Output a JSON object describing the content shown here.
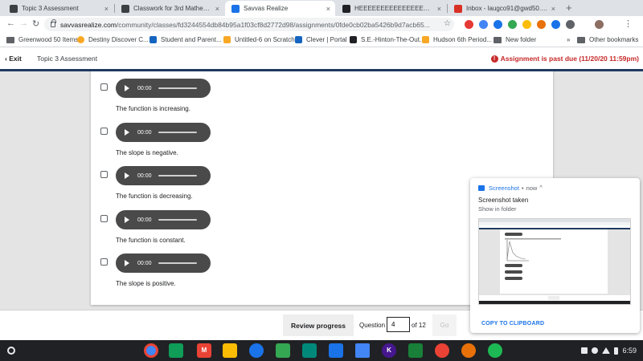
{
  "tabs": [
    {
      "title": "Topic 3 Assessment",
      "favicon_color": "#3c4043",
      "active": false
    },
    {
      "title": "Classwork for 3rd Mathematics",
      "favicon_color": "#3c4043",
      "active": false
    },
    {
      "title": "Savvas Realize",
      "favicon_color": "#1a73e8",
      "active": true
    },
    {
      "title": "HEEEEEEEEEEEEEEEEEEEEEEE",
      "favicon_color": "#202124",
      "active": false
    },
    {
      "title": "Inbox - laugco91@gwd50.org",
      "favicon_color": "#d93025",
      "active": false
    }
  ],
  "tab_close_glyph": "×",
  "new_tab_glyph": "+",
  "omnibox": {
    "host": "savvasrealize.com",
    "path": "/community/classes/fd3244554db84b95a1f03cf8d2772d98/assignments/0fde0cb02ba5426b9d7acb65..."
  },
  "extensions": [
    "#e53935",
    "#4285f4",
    "#1a73e8",
    "#34a853",
    "#fbbc04",
    "#e8710a",
    "#5f6368"
  ],
  "bookmarks": [
    {
      "label": "Greenwood 50 Items",
      "icon": "folder-icon",
      "color": "#5f6368"
    },
    {
      "label": "Destiny Discover C...",
      "icon": "destiny-icon",
      "color": "#f9a825"
    },
    {
      "label": "Student and Parent...",
      "icon": "sis-icon",
      "color": "#1565c0"
    },
    {
      "label": "Untitled-6 on Scratch",
      "icon": "scratch-icon",
      "color": "#f9a825"
    },
    {
      "label": "Clever | Portal",
      "icon": "clever-icon",
      "color": "#1565c0"
    },
    {
      "label": "S.E.-Hinton-The-Out...",
      "icon": "doc-icon",
      "color": "#202124"
    },
    {
      "label": "Hudson 6th Period...",
      "icon": "classroom-icon",
      "color": "#f9a825"
    },
    {
      "label": "New folder",
      "icon": "folder-icon",
      "color": "#5f6368"
    }
  ],
  "bookmarks_overflow": "»",
  "other_bookmarks": "Other bookmarks",
  "header": {
    "exit_label": "Exit",
    "exit_glyph": "‹",
    "assessment_title": "Topic 3 Assessment",
    "warning_glyph": "!",
    "past_due": "Assignment is past due (11/20/20 11:59pm)"
  },
  "options": [
    {
      "text": "The function is increasing.",
      "audio_time": "00:00"
    },
    {
      "text": "The slope is negative.",
      "audio_time": "00:00"
    },
    {
      "text": "The function is decreasing.",
      "audio_time": "00:00"
    },
    {
      "text": "The function is constant.",
      "audio_time": "00:00"
    },
    {
      "text": "The slope is positive.",
      "audio_time": "00:00"
    }
  ],
  "footer": {
    "review_label": "Review progress",
    "question_label": "Question",
    "question_value": "4",
    "of_label": "of 12",
    "go_label": "Go"
  },
  "notification": {
    "app": "Screenshot",
    "dot": "•",
    "when": "now",
    "chevron": "^",
    "title": "Screenshot taken",
    "subtitle": "Show in folder",
    "action": "COPY TO CLIPBOARD"
  },
  "shelf": {
    "apps": [
      {
        "name": "chrome-icon",
        "color": "#4285f4",
        "glyph": ""
      },
      {
        "name": "classroom-app-icon",
        "color": "#0f9d58",
        "glyph": ""
      },
      {
        "name": "gmail-icon",
        "color": "#ea4335",
        "glyph": "M"
      },
      {
        "name": "drive-icon",
        "color": "#fbbc04",
        "glyph": ""
      },
      {
        "name": "settings-icon",
        "color": "#1a73e8",
        "glyph": ""
      },
      {
        "name": "play-store-icon",
        "color": "#34a853",
        "glyph": ""
      },
      {
        "name": "meet-icon",
        "color": "#00897b",
        "glyph": ""
      },
      {
        "name": "files-icon",
        "color": "#1a73e8",
        "glyph": ""
      },
      {
        "name": "docs-icon",
        "color": "#4285f4",
        "glyph": ""
      },
      {
        "name": "kahoot-icon",
        "color": "#46178f",
        "glyph": "K"
      },
      {
        "name": "classroom-icon-2",
        "color": "#188038",
        "glyph": ""
      },
      {
        "name": "maps-icon",
        "color": "#ea4335",
        "glyph": ""
      },
      {
        "name": "photos-icon",
        "color": "#e8710a",
        "glyph": ""
      },
      {
        "name": "spotify-icon",
        "color": "#1db954",
        "glyph": ""
      }
    ],
    "time": "6:59"
  }
}
